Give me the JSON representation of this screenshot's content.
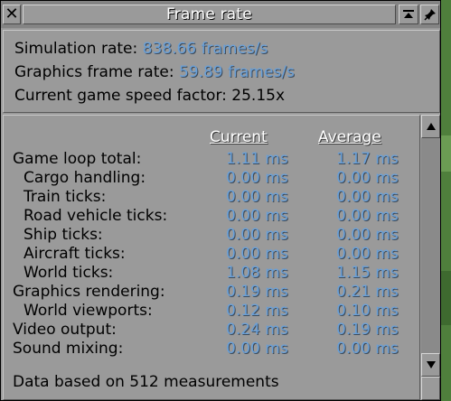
{
  "window": {
    "title": "Frame rate",
    "close_icon": "x-close-icon",
    "shade_icon": "shade-icon",
    "sticky_icon": "pin-icon"
  },
  "rates": [
    {
      "label": "Simulation rate: ",
      "value": "838.66 frames/s"
    },
    {
      "label": "Graphics frame rate: ",
      "value": "59.89 frames/s"
    },
    {
      "label": "Current game speed factor: 25.15x",
      "value": ""
    }
  ],
  "table": {
    "headers": {
      "current": "Current",
      "average": "Average"
    },
    "rows": [
      {
        "label": "Game loop total:",
        "current": "1.11 ms",
        "average": "1.17 ms"
      },
      {
        "label": "Cargo handling:",
        "current": "0.00 ms",
        "average": "0.00 ms"
      },
      {
        "label": "Train ticks:",
        "current": "0.00 ms",
        "average": "0.00 ms"
      },
      {
        "label": "Road vehicle ticks:",
        "current": "0.00 ms",
        "average": "0.00 ms"
      },
      {
        "label": "Ship ticks:",
        "current": "0.00 ms",
        "average": "0.00 ms"
      },
      {
        "label": "Aircraft ticks:",
        "current": "0.00 ms",
        "average": "0.00 ms"
      },
      {
        "label": "World ticks:",
        "current": "1.08 ms",
        "average": "1.15 ms"
      },
      {
        "label": "Graphics rendering:",
        "current": "0.19 ms",
        "average": "0.21 ms"
      },
      {
        "label": "World viewports:",
        "current": "0.12 ms",
        "average": "0.10 ms"
      },
      {
        "label": "Video output:",
        "current": "0.24 ms",
        "average": "0.19 ms"
      },
      {
        "label": "Sound mixing:",
        "current": "0.00 ms",
        "average": "0.00 ms"
      }
    ]
  },
  "footer": "Data based on 512 measurements",
  "scrollbar": {
    "up_icon": "scroll-up-icon",
    "down_icon": "scroll-down-icon"
  },
  "colors": {
    "value_blue": "#6aa0d8",
    "window_gray": "#9a9a9a"
  }
}
